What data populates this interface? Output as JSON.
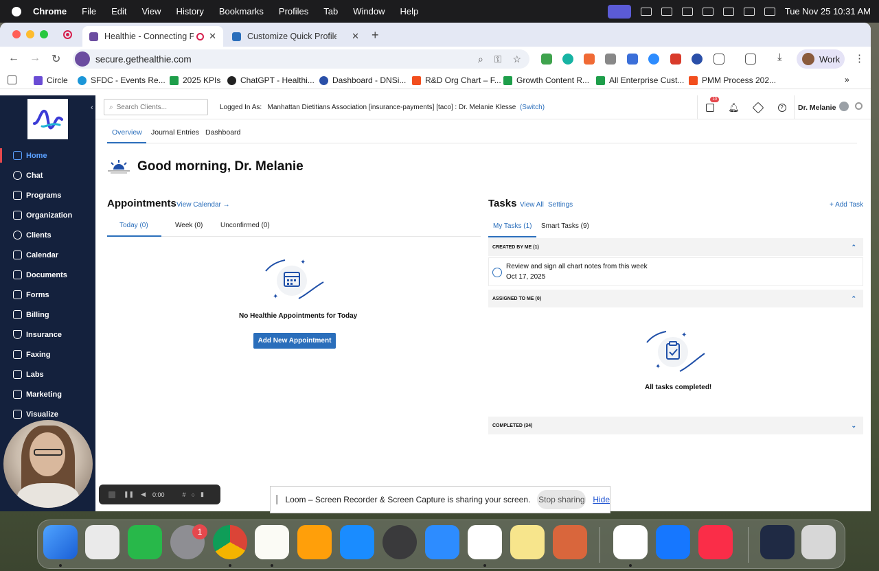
{
  "menubar": {
    "app_name": "Chrome",
    "items": [
      "File",
      "Edit",
      "View",
      "History",
      "Bookmarks",
      "Profiles",
      "Tab",
      "Window",
      "Help"
    ],
    "clock": "Tue Nov 25  10:31 AM"
  },
  "browser": {
    "tabs": [
      {
        "label": "Healthie - Connecting Pro",
        "active": true
      },
      {
        "label": "Customize Quick Profile - Adr",
        "active": false
      }
    ],
    "url": "secure.gethealthie.com",
    "profile": "Work",
    "bookmarks": [
      "Circle",
      "SFDC - Events Re...",
      "2025 KPIs",
      "ChatGPT - Healthi...",
      "Dashboard - DNSi...",
      "R&D Org Chart – F...",
      "Growth Content R...",
      "All Enterprise Cust...",
      "PMM Process 202..."
    ]
  },
  "sidebar": {
    "items": [
      "Home",
      "Chat",
      "Programs",
      "Organization",
      "Clients",
      "Calendar",
      "Documents",
      "Forms",
      "Billing",
      "Insurance",
      "Faxing",
      "Labs",
      "Marketing",
      "Visualize"
    ]
  },
  "topbar": {
    "search_placeholder": "Search Clients...",
    "logged_in_label": "Logged In As:",
    "logged_in_value": "Manhattan Dietitians Association [insurance-payments] [taco] : Dr. Melanie Klesse",
    "switch_label": "(Switch)",
    "task_badge": "10",
    "user_name": "Dr. Melanie"
  },
  "subtabs": [
    "Overview",
    "Journal Entries",
    "Dashboard"
  ],
  "greeting": "Good morning, Dr. Melanie",
  "appointments": {
    "title": "Appointments",
    "view_calendar": "View Calendar →",
    "tabs": [
      "Today (0)",
      "Week (0)",
      "Unconfirmed (0)"
    ],
    "empty_text": "No Healthie Appointments for Today",
    "add_button": "Add New Appointment"
  },
  "tasks": {
    "title": "Tasks",
    "view_all": "View All",
    "settings": "Settings",
    "add_task": "+ Add Task",
    "tabs": [
      "My Tasks (1)",
      "Smart Tasks (9)"
    ],
    "created_by_me": "CREATED BY ME (1)",
    "task_text": "Review and sign all chart notes from this week",
    "task_date": "Oct 17, 2025",
    "assigned_to_me": "ASSIGNED TO ME (0)",
    "all_completed": "All tasks completed!",
    "completed": "COMPLETED (34)"
  },
  "loom": {
    "timer": "0:00",
    "share_message": "Loom – Screen Recorder & Screen Capture is sharing your screen.",
    "stop_sharing": "Stop sharing",
    "hide": "Hide"
  },
  "dock": {
    "settings_badge": "1"
  }
}
